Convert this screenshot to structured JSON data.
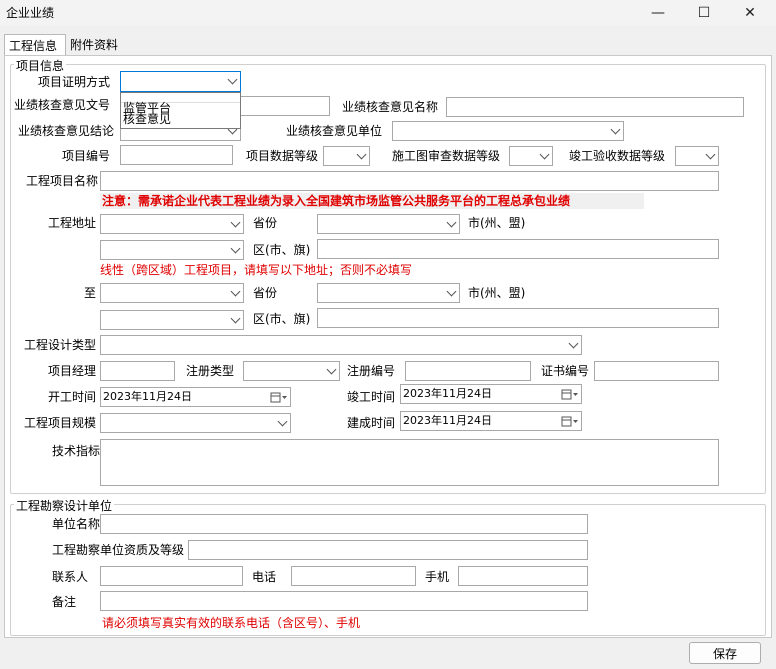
{
  "window": {
    "title": "企业业绩",
    "minimize": "—",
    "maximize": "☐",
    "close": "✕"
  },
  "tabs": [
    "工程信息",
    "附件资料"
  ],
  "project": {
    "legend": "项目信息",
    "proof_method_label": "项目证明方式",
    "proof_options": [
      "监管平台",
      "核查意见"
    ],
    "verify_doc_label": "业绩核查意见文号",
    "verify_name_label": "业绩核查意见名称",
    "verify_result_label": "业绩核查意见结论",
    "verify_unit_label": "业绩核查意见单位",
    "project_no_label": "项目编号",
    "data_level_label": "项目数据等级",
    "drawing_review_label": "施工图审查数据等级",
    "acceptance_label": "竣工验收数据等级",
    "project_name_label": "工程项目名称",
    "notice": "注意：需承诺企业代表工程业绩为录入全国建筑市场监管公共服务平台的工程总承包业绩",
    "address_label": "工程地址",
    "province_label": "省份",
    "city_label": "市(州、盟)",
    "district_label": "区(市、旗)",
    "linear_notice": "线性（跨区域）工程项目，请填写以下地址；否则不必填写",
    "to_label": "至",
    "design_type_label": "工程设计类型",
    "manager_label": "项目经理",
    "reg_type_label": "注册类型",
    "reg_no_label": "注册编号",
    "cert_no_label": "证书编号",
    "start_label": "开工时间",
    "start_value": "2023年11月24日",
    "finish_label": "竣工时间",
    "finish_value": "2023年11月24日",
    "scale_label": "工程项目规模",
    "built_label": "建成时间",
    "built_value": "2023年11月24日",
    "tech_label": "技术指标"
  },
  "survey": {
    "legend": "工程勘察设计单位",
    "unit_name_label": "单位名称",
    "qual_label": "工程勘察单位资质及等级",
    "contact_label": "联系人",
    "phone_label": "电话",
    "mobile_label": "手机",
    "remark_label": "备注",
    "phone_notice": "请必须填写真实有效的联系电话（含区号）、手机"
  },
  "footer": {
    "save_label": "保存"
  },
  "colors": {
    "warning": "#e00000",
    "highlight_border": "#0078d7"
  }
}
